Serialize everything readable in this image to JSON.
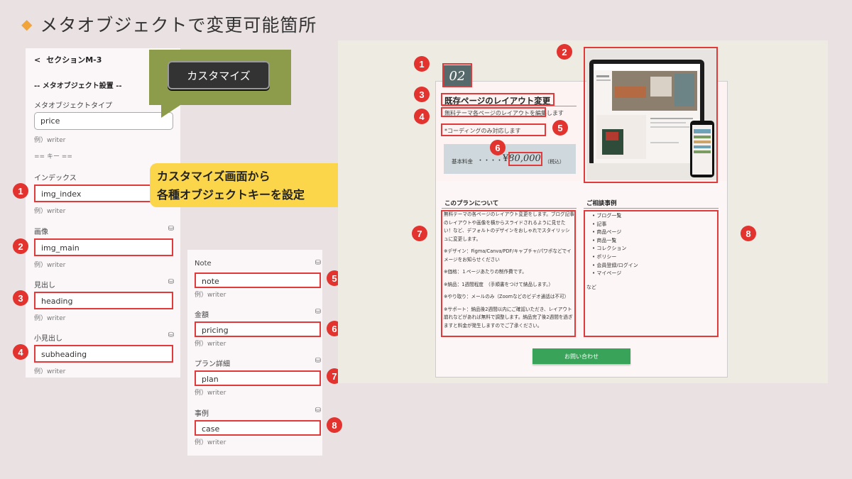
{
  "slide": {
    "title": "メタオブジェクトで変更可能箇所"
  },
  "left_panel": {
    "back_icon": "chevron-left-icon",
    "section_title": "セクションM-3",
    "meta_heading": "-- メタオブジェクト設置 --",
    "type_label": "メタオブジェクトタイプ",
    "type_value": "price",
    "type_example": "例）writer",
    "key_heading": "== キー ==",
    "fields": [
      {
        "num": "1",
        "label": "インデックス",
        "value": "img_index",
        "example": "例）writer",
        "db": false
      },
      {
        "num": "2",
        "label": "画像",
        "value": "img_main",
        "example": "例）writer",
        "db": true
      },
      {
        "num": "3",
        "label": "見出し",
        "value": "heading",
        "example": "例）writer",
        "db": true
      },
      {
        "num": "4",
        "label": "小見出し",
        "value": "subheading",
        "example": "例）writer",
        "db": true
      }
    ]
  },
  "right_panel": {
    "fields": [
      {
        "num": "5",
        "label": "Note",
        "value": "note",
        "example": "例）writer"
      },
      {
        "num": "6",
        "label": "金額",
        "value": "pricing",
        "example": "例）writer"
      },
      {
        "num": "7",
        "label": "プラン詳細",
        "value": "plan",
        "example": "例）writer"
      },
      {
        "num": "8",
        "label": "事例",
        "value": "case",
        "example": "例）writer"
      }
    ]
  },
  "callout": {
    "button": "カスタマイズ",
    "color": "#8d9c4a"
  },
  "note_box": {
    "line1": "カスタマイズ画面から",
    "line2": "各種オブジェクトキーを設定",
    "color": "#fbd54a"
  },
  "preview": {
    "badge": "02",
    "heading": "既存ページのレイアウト変更",
    "subheading": "無料テーマ各ページのレイアウトを編集します",
    "note": "*コーディングのみ対応します",
    "price_label": "基本料金",
    "price_dots": "・・・・",
    "price_yen": "¥",
    "price_amount": "80,000",
    "price_tax": "（税込）",
    "plan_title": "このプランについて",
    "case_title": "ご相談事例",
    "plan_paragraphs": [
      "無料テーマの各ページのレイアウト変更をします。ブログ記事のレイアウトや画像を横からスライドされるように見せたい！など、デフォルトのデザインをおしゃれでスタイリッシュに変更します。",
      "※デザイン：Figma/Canva/PDF/キャプチャ/パワポなどでイメージをお知らせください",
      "※価格：１ページあたりの制作費です。",
      "※納品：1週間程度　（手順書をつけて納品します。）",
      "※やり取り：メールのみ（Zoomなどのビデオ通話は不可）",
      "※サポート：納品後2週間以内にご確認いただき、レイアウト崩れなどがあれば無料で調整します。納品完了後2週間を過ぎますと料金が発生しますのでご了承ください。"
    ],
    "case_items": [
      "ブログ一覧",
      "記事",
      "商品ページ",
      "商品一覧",
      "コレクション",
      "ポリシー",
      "会員登録/ログイン",
      "マイページ"
    ],
    "case_etc": "など",
    "contact_button": "お問い合わせ",
    "accent": "#e23a3a"
  }
}
